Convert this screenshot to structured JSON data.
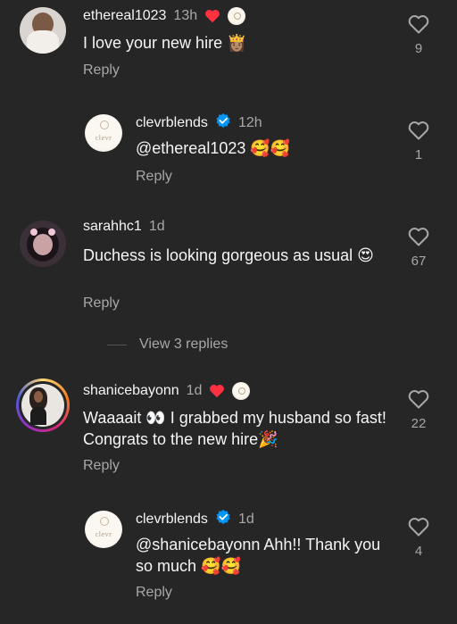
{
  "comments": [
    {
      "username": "ethereal1023",
      "time": "13h",
      "text": "I love your new hire 👸🏽",
      "reply_label": "Reply",
      "likes": "9"
    },
    {
      "username": "clevrblends",
      "time": "12h",
      "text": "@ethereal1023 🥰🥰",
      "reply_label": "Reply",
      "likes": "1",
      "avatar_label": "clevr"
    },
    {
      "username": "sarahhc1",
      "time": "1d",
      "text": "Duchess is looking gorgeous as usual 😍",
      "reply_label": "Reply",
      "likes": "67"
    },
    {
      "username": "shanicebayonn",
      "time": "1d",
      "text": "Waaaait 👀 I grabbed my husband so fast! Congrats to the new hire🎉",
      "reply_label": "Reply",
      "likes": "22"
    },
    {
      "username": "clevrblends",
      "time": "1d",
      "text": "@shanicebayonn Ahh!! Thank you so much 🥰🥰",
      "reply_label": "Reply",
      "likes": "4",
      "avatar_label": "clevr"
    }
  ],
  "view_replies": "View 3 replies",
  "colors": {
    "background": "#262626",
    "secondary_text": "#a8a8a8",
    "heart_red": "#ff3040",
    "verified_blue": "#0095f6"
  }
}
